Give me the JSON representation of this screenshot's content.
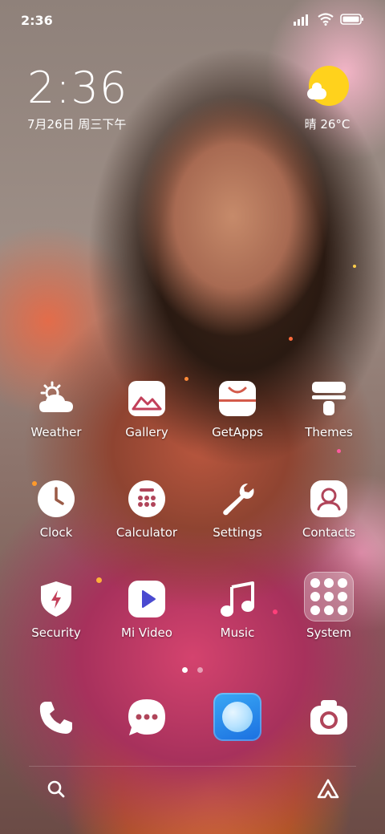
{
  "status_bar": {
    "time": "2:36"
  },
  "clock_widget": {
    "time": "2:36",
    "date": "7月26日 周三下午"
  },
  "weather_widget": {
    "condition": "晴",
    "temp": "26°C",
    "text": "晴 26°C"
  },
  "apps": [
    {
      "label": "Weather",
      "icon": "weather-icon"
    },
    {
      "label": "Gallery",
      "icon": "gallery-icon"
    },
    {
      "label": "GetApps",
      "icon": "getapps-icon"
    },
    {
      "label": "Themes",
      "icon": "themes-icon"
    },
    {
      "label": "Clock",
      "icon": "clock-icon"
    },
    {
      "label": "Calculator",
      "icon": "calculator-icon"
    },
    {
      "label": "Settings",
      "icon": "settings-icon"
    },
    {
      "label": "Contacts",
      "icon": "contacts-icon"
    },
    {
      "label": "Security",
      "icon": "security-icon"
    },
    {
      "label": "Mi Video",
      "icon": "mi-video-icon"
    },
    {
      "label": "Music",
      "icon": "music-icon"
    },
    {
      "label": "System",
      "icon": "system-folder-icon"
    }
  ],
  "page_indicator": {
    "pages": 2,
    "current": 1
  },
  "dock": [
    {
      "icon": "phone-icon"
    },
    {
      "icon": "messages-icon"
    },
    {
      "icon": "browser-icon"
    },
    {
      "icon": "camera-icon"
    }
  ],
  "bottom_bar": {
    "left_icon": "search-icon",
    "right_icon": "assistant-icon"
  },
  "colors": {
    "weather_sun": "#ffd21c",
    "browser_blue": "#1b6fe0"
  }
}
